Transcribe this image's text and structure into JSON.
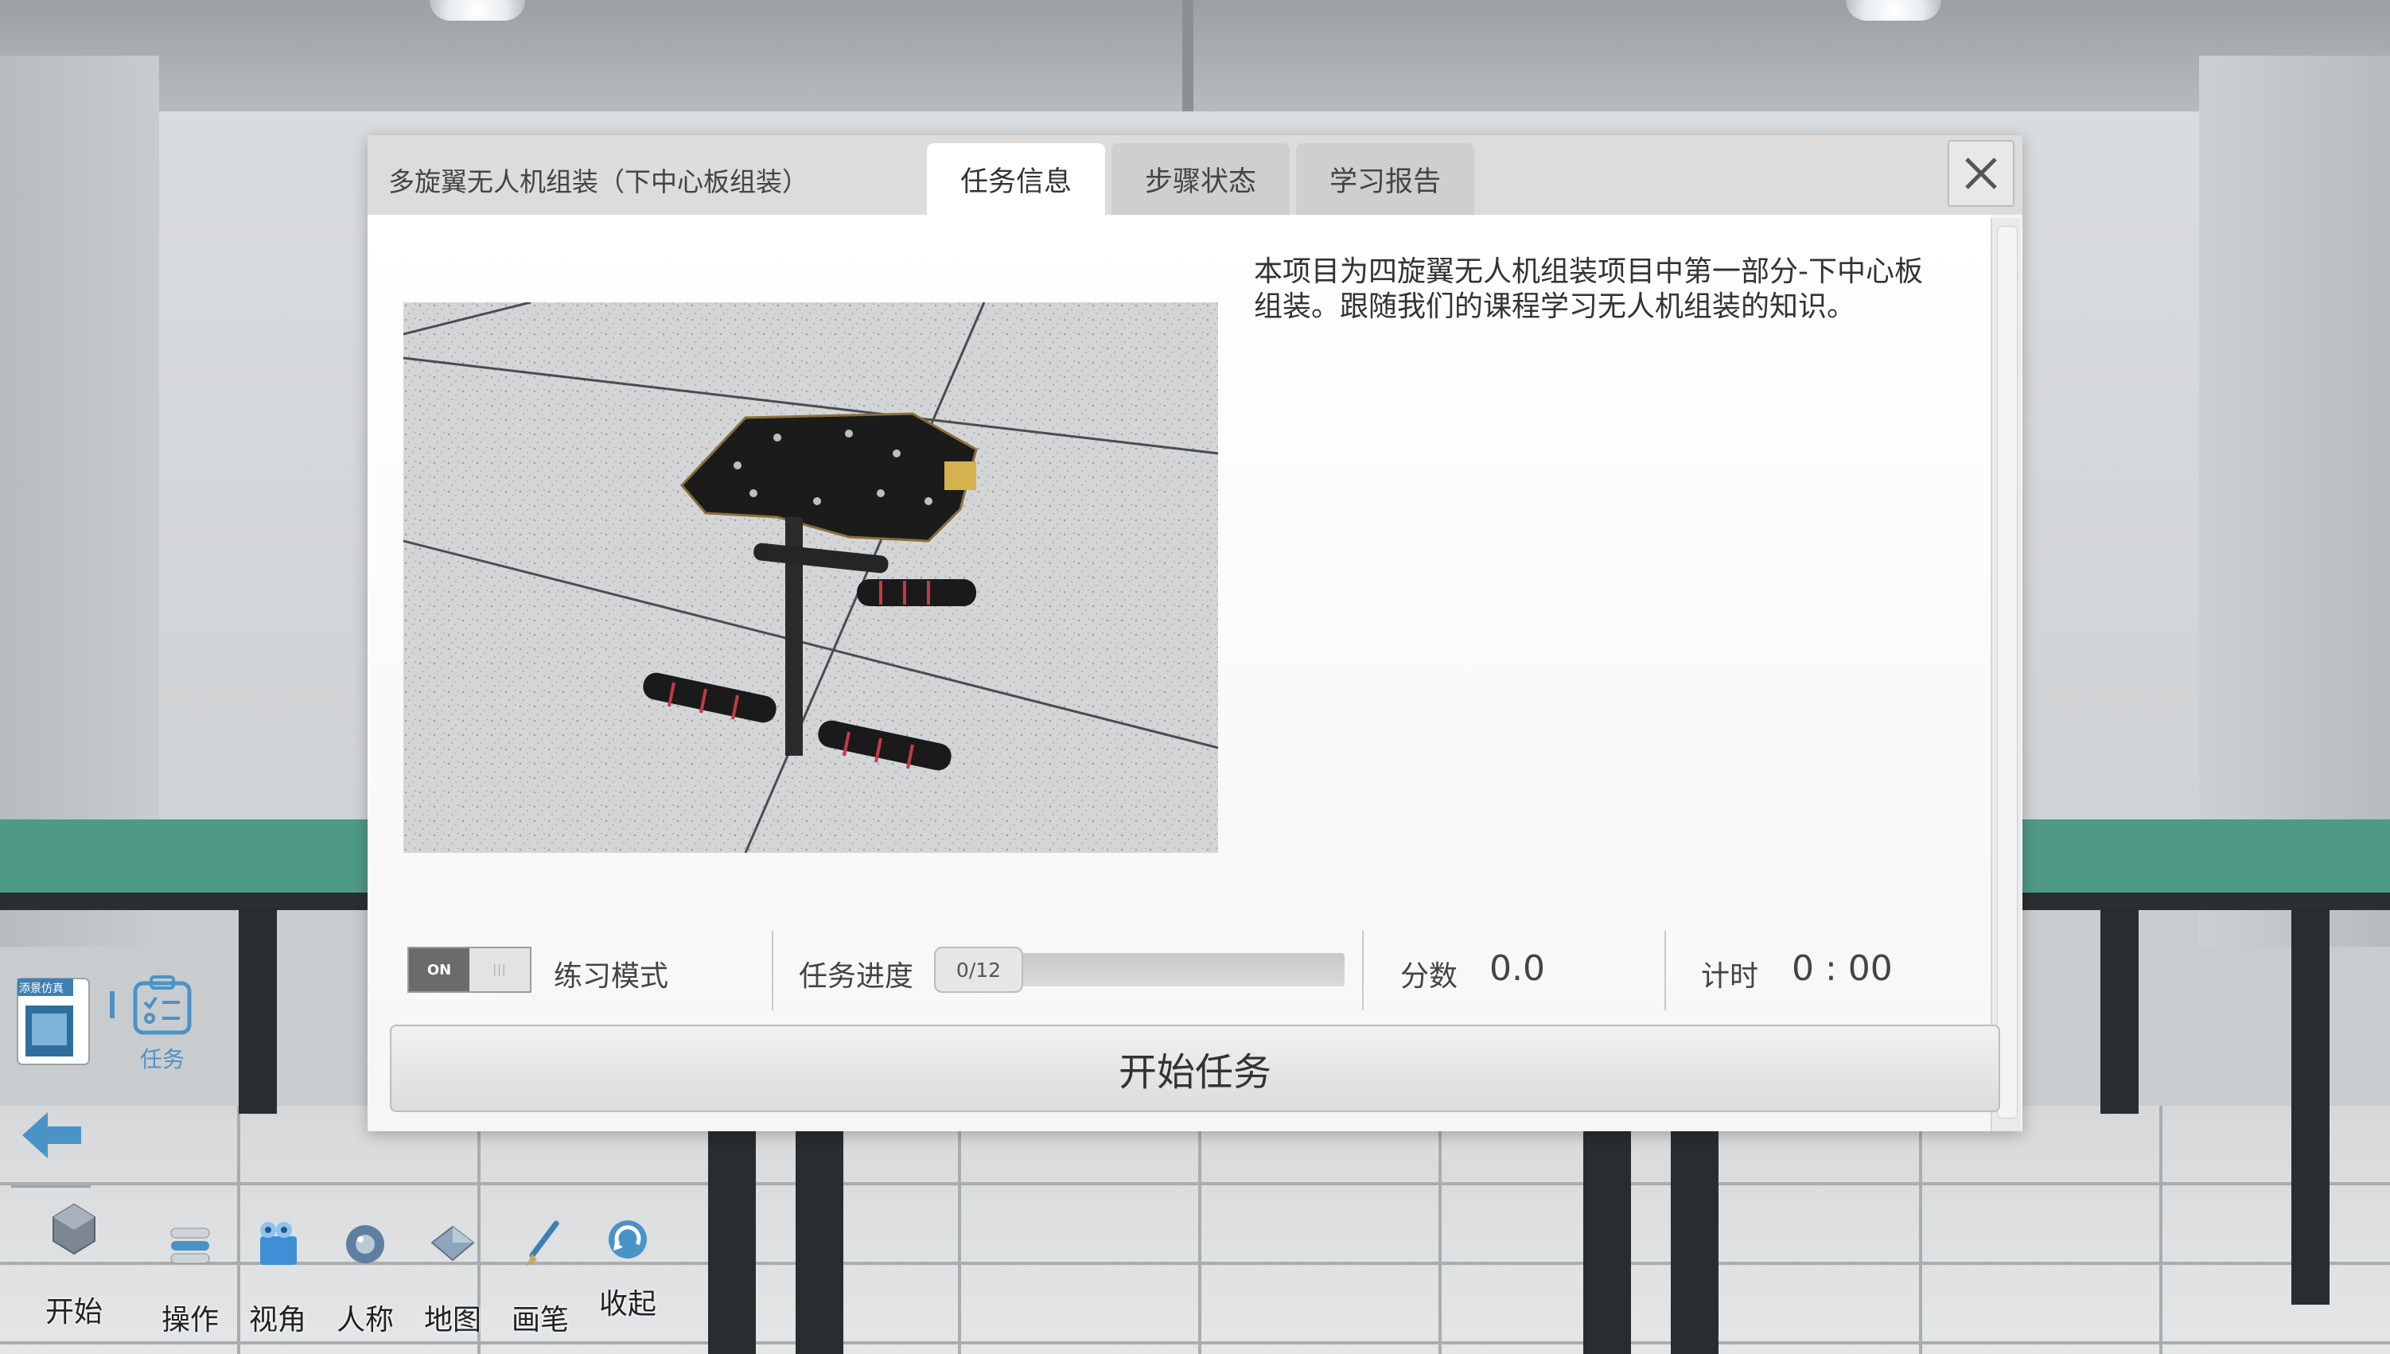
{
  "modal": {
    "title": "多旋翼无人机组装（下中心板组装）",
    "tabs": [
      {
        "label": "任务信息",
        "active": true
      },
      {
        "label": "步骤状态",
        "active": false
      },
      {
        "label": "学习报告",
        "active": false
      }
    ],
    "description": "本项目为四旋翼无人机组装项目中第一部分-下中心板组装。跟随我们的课程学习无人机组装的知识。",
    "practice_mode": {
      "toggle_text": "ON",
      "label": "练习模式",
      "enabled": true
    },
    "progress": {
      "label": "任务进度",
      "value_text": "0/12",
      "fraction": 0.0
    },
    "score": {
      "label": "分数",
      "value": "0.0"
    },
    "timer": {
      "label": "计时",
      "value": "0 : 00"
    },
    "start_button": "开始任务"
  },
  "side": {
    "logo_text": "添景仿真",
    "task_label": "任务"
  },
  "toolbar": {
    "items": [
      {
        "label": "开始",
        "icon": "cube-icon"
      },
      {
        "label": "操作",
        "icon": "layers-icon"
      },
      {
        "label": "视角",
        "icon": "camera-icon"
      },
      {
        "label": "人称",
        "icon": "sphere-icon"
      },
      {
        "label": "地图",
        "icon": "map-icon"
      },
      {
        "label": "画笔",
        "icon": "brush-icon"
      },
      {
        "label": "收起",
        "icon": "collapse-icon"
      }
    ]
  },
  "colors": {
    "bench": "#4f9a86",
    "accent_blue": "#4a93c7",
    "progress_fill": "#8cbf6a"
  }
}
